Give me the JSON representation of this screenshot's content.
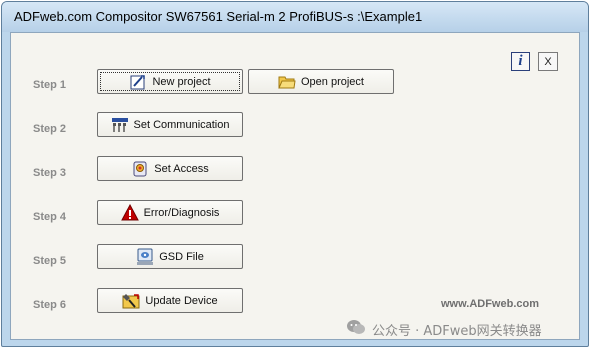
{
  "window": {
    "title": "ADFweb.com Compositor SW67561 Serial-m 2 ProfiBUS-s :\\Example1"
  },
  "toolbar": {
    "info_label": "i",
    "close_label": "X"
  },
  "steps": [
    {
      "label": "Step 1",
      "buttons": [
        {
          "label": "New project",
          "icon": "new-project-icon"
        },
        {
          "label": "Open project",
          "icon": "open-folder-icon"
        }
      ]
    },
    {
      "label": "Step 2",
      "buttons": [
        {
          "label": "Set Communication",
          "icon": "communication-icon"
        }
      ]
    },
    {
      "label": "Step 3",
      "buttons": [
        {
          "label": "Set Access",
          "icon": "access-icon"
        }
      ]
    },
    {
      "label": "Step 4",
      "buttons": [
        {
          "label": "Error/Diagnosis",
          "icon": "warning-icon"
        }
      ]
    },
    {
      "label": "Step 5",
      "buttons": [
        {
          "label": "GSD File",
          "icon": "gsd-file-icon"
        }
      ]
    },
    {
      "label": "Step 6",
      "buttons": [
        {
          "label": "Update Device",
          "icon": "update-device-icon"
        }
      ]
    }
  ],
  "footer": {
    "website": "www.ADFweb.com",
    "watermark": "公众号 · ADFweb网关转换器"
  },
  "colors": {
    "titlebar": "#bcd6ec",
    "client_bg": "#f5f4ef",
    "step_label": "#8a8a8a",
    "warning": "#c00000"
  }
}
